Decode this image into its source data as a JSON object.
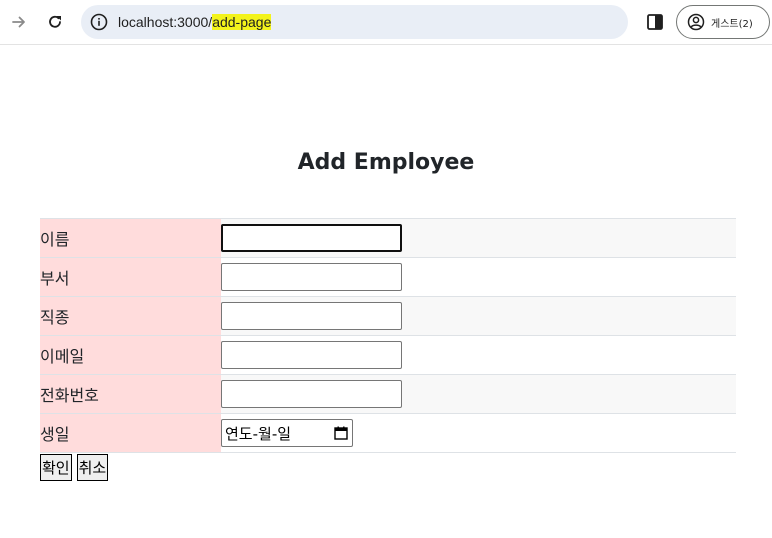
{
  "browser": {
    "url_host": "localhost:3000/",
    "url_path": "add-page",
    "profile_label": "게스트(2)",
    "icons": [
      "forward-arrow-icon",
      "reload-icon",
      "info-icon",
      "side-panel-icon",
      "profile-icon"
    ]
  },
  "page": {
    "title": "Add Employee",
    "fields": [
      {
        "label": "이름",
        "type": "text",
        "value": ""
      },
      {
        "label": "부서",
        "type": "text",
        "value": ""
      },
      {
        "label": "직종",
        "type": "text",
        "value": ""
      },
      {
        "label": "이메일",
        "type": "text",
        "value": ""
      },
      {
        "label": "전화번호",
        "type": "text",
        "value": ""
      },
      {
        "label": "생일",
        "type": "date",
        "placeholder": "연도-월-일"
      }
    ],
    "confirm_label": "확인",
    "cancel_label": "취소"
  },
  "colors": {
    "label_bg": "#ffdcdc",
    "stripe_bg": "#f8f8f8",
    "url_highlight": "#f3f31c"
  }
}
